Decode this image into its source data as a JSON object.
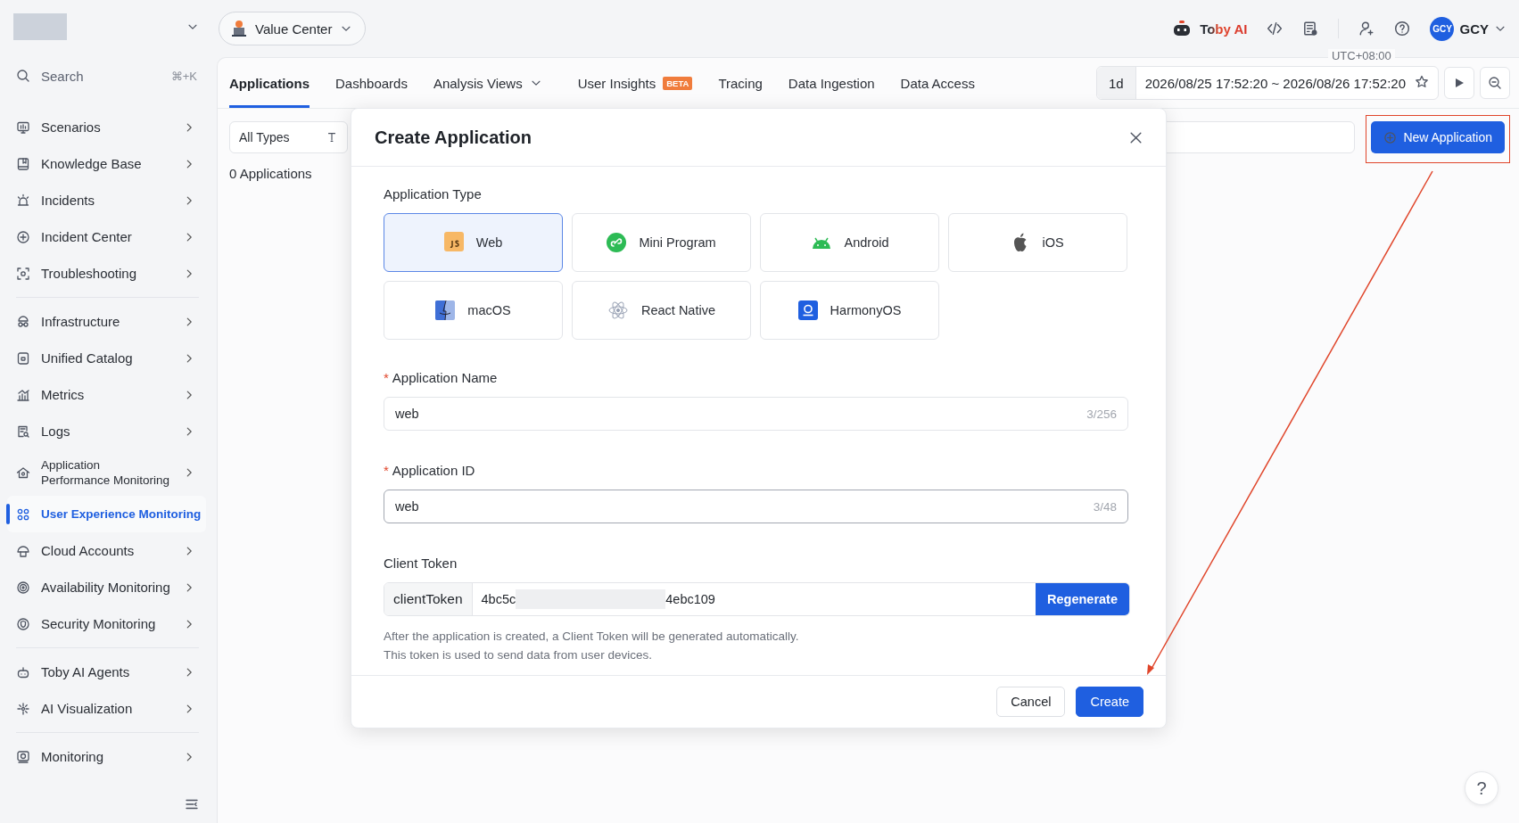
{
  "sidebar": {
    "search": {
      "placeholder": "Search",
      "shortcut": "⌘+K"
    },
    "groups": [
      {
        "items": [
          {
            "label": "Scenarios",
            "selected": false,
            "expandable": true
          },
          {
            "label": "Knowledge Base",
            "selected": false,
            "expandable": true
          },
          {
            "label": "Incidents",
            "selected": false,
            "expandable": true
          },
          {
            "label": "Incident Center",
            "selected": false,
            "expandable": true
          },
          {
            "label": "Troubleshooting",
            "selected": false,
            "expandable": true
          }
        ]
      },
      {
        "items": [
          {
            "label": "Infrastructure",
            "selected": false,
            "expandable": true
          },
          {
            "label": "Unified Catalog",
            "selected": false,
            "expandable": true
          },
          {
            "label": "Metrics",
            "selected": false,
            "expandable": true
          },
          {
            "label": "Logs",
            "selected": false,
            "expandable": true
          },
          {
            "label": "Application Performance Monitoring",
            "selected": false,
            "expandable": true
          },
          {
            "label": "User Experience Monitoring",
            "selected": true,
            "expandable": false
          },
          {
            "label": "Cloud Accounts",
            "selected": false,
            "expandable": true
          },
          {
            "label": "Availability Monitoring",
            "selected": false,
            "expandable": true
          },
          {
            "label": "Security Monitoring",
            "selected": false,
            "expandable": true
          }
        ]
      },
      {
        "items": [
          {
            "label": "Toby AI Agents",
            "selected": false,
            "expandable": true
          },
          {
            "label": "AI Visualization",
            "selected": false,
            "expandable": true
          }
        ]
      },
      {
        "items": [
          {
            "label": "Monitoring",
            "selected": false,
            "expandable": true
          }
        ]
      }
    ]
  },
  "workspace": {
    "label": "Value Center"
  },
  "header": {
    "assistant": "Toby AI",
    "user": {
      "initials": "GCY",
      "name": "GCY"
    }
  },
  "tabs": [
    {
      "label": "Applications",
      "selected": true,
      "menu": false
    },
    {
      "label": "Dashboards",
      "selected": false,
      "menu": false
    },
    {
      "label": "Analysis Views",
      "selected": false,
      "menu": true
    },
    {
      "label": "User Insights",
      "selected": false,
      "menu": false,
      "badge": "BETA"
    },
    {
      "label": "Tracing",
      "selected": false,
      "menu": false
    },
    {
      "label": "Data Ingestion",
      "selected": false,
      "menu": false
    },
    {
      "label": "Data Access",
      "selected": false,
      "menu": false
    }
  ],
  "time": {
    "timezone": "UTC+08:00",
    "quick": "1d",
    "range": "2026/08/25 17:52:20 ~ 2026/08/26 17:52:20"
  },
  "toolbar": {
    "type_filter": "All Types",
    "count": "0 Applications",
    "new_button": "New Application"
  },
  "dialog": {
    "title": "Create Application",
    "type_label": "Application Type",
    "types": [
      {
        "label": "Web",
        "selected": true
      },
      {
        "label": "Mini Program",
        "selected": false
      },
      {
        "label": "Android",
        "selected": false
      },
      {
        "label": "iOS",
        "selected": false
      },
      {
        "label": "macOS",
        "selected": false
      },
      {
        "label": "React Native",
        "selected": false
      },
      {
        "label": "HarmonyOS",
        "selected": false
      }
    ],
    "fields": [
      {
        "label": "Application Name",
        "required_mark": "*",
        "value": "web",
        "count": "3/256",
        "focused": false
      },
      {
        "label": "Application ID",
        "required_mark": "*",
        "value": "web",
        "count": "3/48",
        "focused": true
      }
    ],
    "token": {
      "label": "Client Token",
      "prefix": "clientToken",
      "start": "4bc5c",
      "end": "4ebc109",
      "button": "Regenerate"
    },
    "help": [
      "After the application is created, a Client Token will be generated automatically.",
      "This token is used to send data from user devices."
    ],
    "cancel": "Cancel",
    "create": "Create"
  },
  "help_button": "?"
}
